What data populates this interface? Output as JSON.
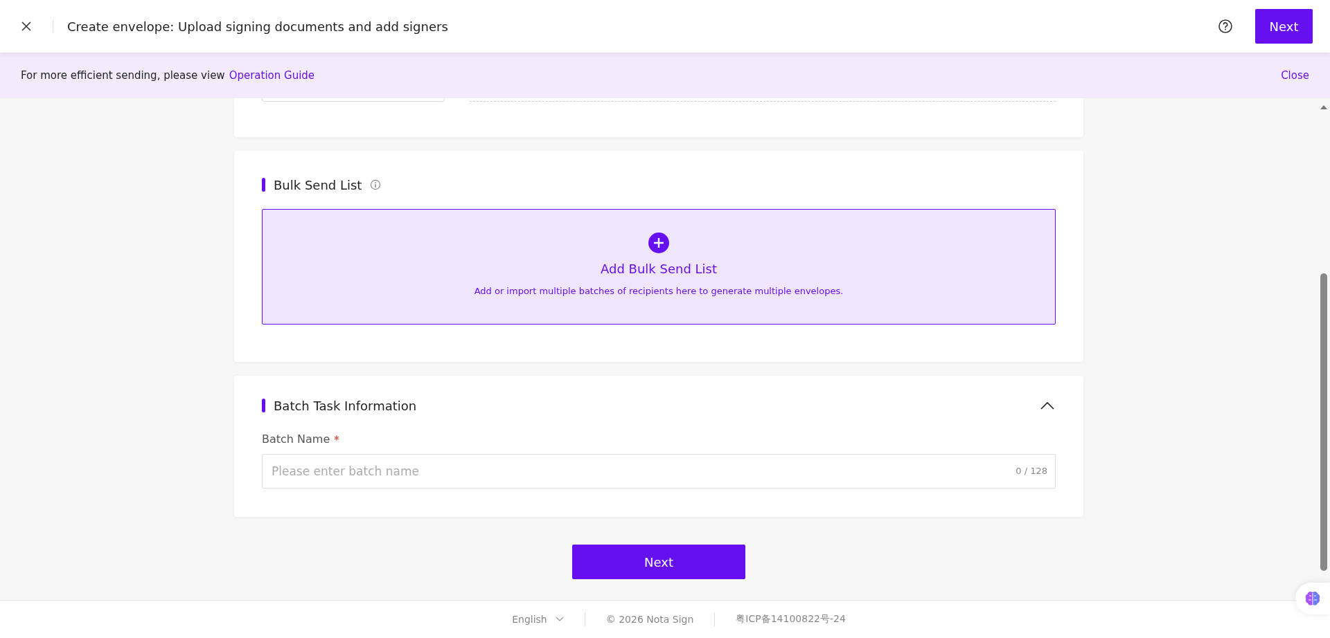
{
  "header": {
    "title": "Create envelope: Upload signing documents and add signers",
    "next_button": "Next"
  },
  "banner": {
    "text": "For more efficient sending, please view",
    "link": "Operation Guide",
    "close": "Close"
  },
  "bulk_send": {
    "title": "Bulk Send List",
    "add_title": "Add Bulk Send List",
    "add_description": "Add or import multiple batches of recipients here to generate multiple envelopes."
  },
  "batch_task": {
    "title": "Batch Task Information",
    "expanded": true,
    "field_label": "Batch Name",
    "required": true,
    "placeholder": "Please enter batch name",
    "counter": "0 / 128"
  },
  "next_button": "Next",
  "footer": {
    "language": "English",
    "copyright": "© 2026 Nota Sign",
    "icp": "粤ICP备14100822号-24"
  }
}
